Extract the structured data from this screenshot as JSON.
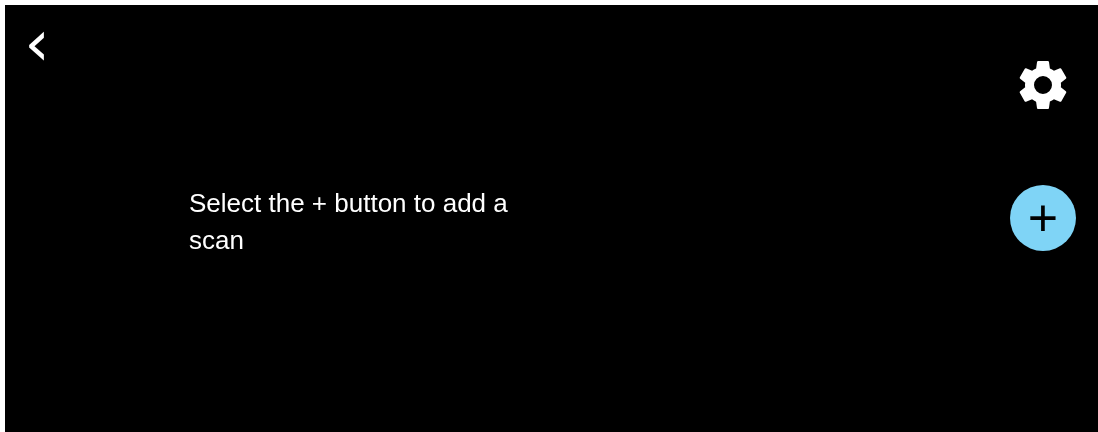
{
  "top_bar": {
    "back": "‹"
  },
  "message": "Select the + button to add a scan",
  "add_button": {
    "label": "+"
  }
}
